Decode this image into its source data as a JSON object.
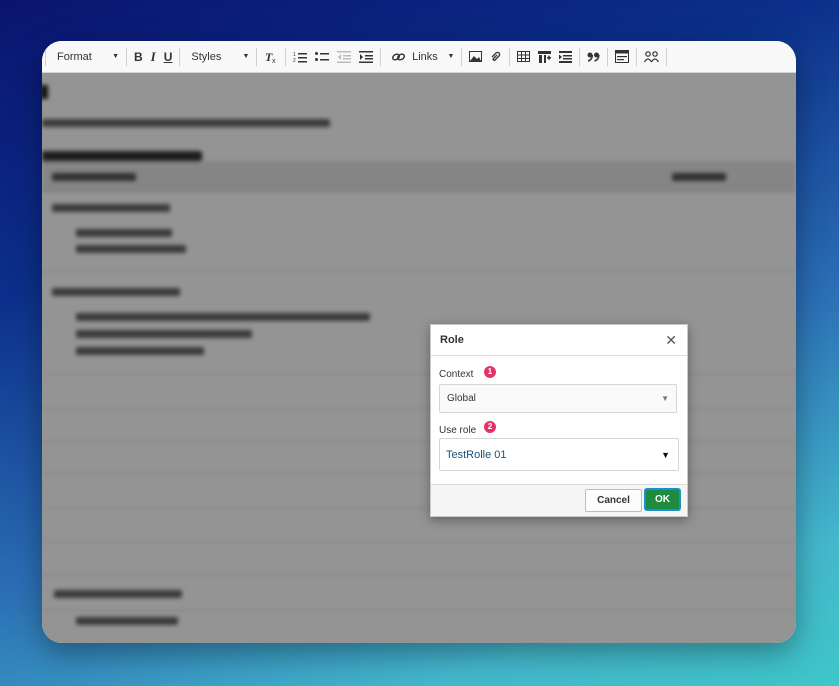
{
  "toolbar": {
    "format_label": "Format",
    "bold_label": "B",
    "italic_label": "I",
    "underline_label": "U",
    "styles_label": "Styles",
    "links_label": "Links"
  },
  "dialog": {
    "title": "Role",
    "context_label": "Context",
    "context_badge": "1",
    "context_value": "Global",
    "use_role_label": "Use role",
    "use_role_badge": "2",
    "use_role_value": "TestRolle 01",
    "cancel_label": "Cancel",
    "ok_label": "OK"
  },
  "colors": {
    "ok_button": "#1f8b3f",
    "ok_focus_ring": "#1a8fd6",
    "badge": "#e8336a",
    "selected_value": "#1a5276"
  },
  "icons": [
    "dropdown-caret-icon",
    "remove-format-icon",
    "numbered-list-icon",
    "bulleted-list-icon",
    "outdent-icon",
    "indent-icon",
    "link-icon",
    "image-icon",
    "attachment-icon",
    "table-icon",
    "insert-column-icon",
    "insert-row-icon",
    "blockquote-icon",
    "source-icon",
    "users-icon",
    "close-icon",
    "chevron-down-icon"
  ]
}
